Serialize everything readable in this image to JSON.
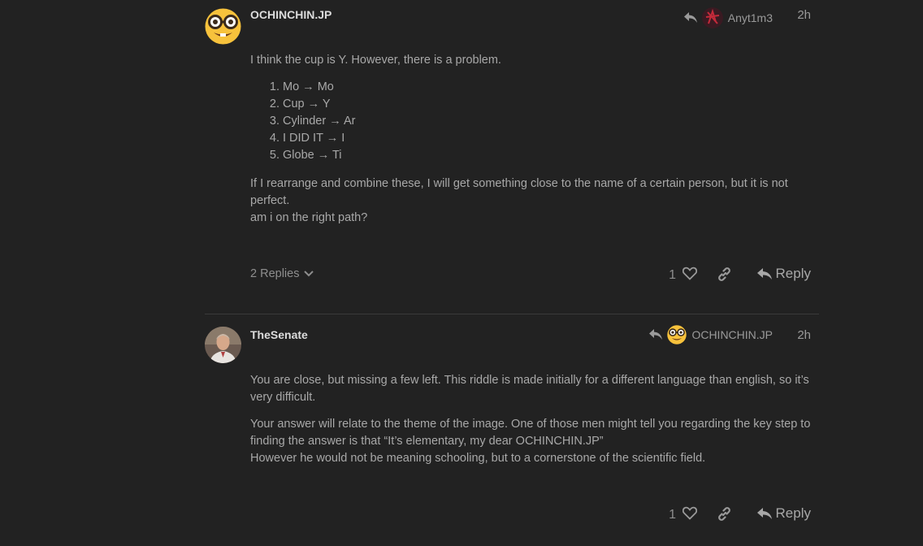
{
  "posts": [
    {
      "username": "OCHINCHIN.JP",
      "avatar_icon": "nerd-face-emoji-icon",
      "reply_to_user": "Anyt1m3",
      "age": "2h",
      "paragraph1": "I think the cup is Y. However, there is a problem.",
      "list": [
        "Mo → Mo",
        "Cup → Y",
        "Cylinder → Ar",
        "I DID IT → I",
        "Globe → Ti"
      ],
      "paragraph2_line1": "If I rearrange and combine these, I will get something close to the name of a certain person, but it is not perfect.",
      "paragraph2_line2": "am i on the right path?",
      "replies_label": "2 Replies",
      "likes": "1",
      "reply_label": "Reply"
    },
    {
      "username": "TheSenate",
      "avatar_icon": "user-photo-avatar",
      "reply_to_user": "OCHINCHIN.JP",
      "age": "2h",
      "paragraph1": "You are close, but missing a few left. This riddle is made initially for a different language than english, so it’s very difficult.",
      "paragraph2_line1": "Your answer will relate to the theme of the image. One of those men might tell you regarding the key step to finding the answer is that “It’s elementary, my dear OCHINCHIN.JP”",
      "paragraph2_line2": "However he would not be meaning schooling, but to a cornerstone of the scientific field.",
      "likes": "1",
      "reply_label": "Reply"
    }
  ],
  "colors": {
    "background": "#222222",
    "text": "#a8a8a8",
    "username": "#dcdcdc",
    "muted": "#8e8e8e",
    "divider": "#3a3a3a"
  }
}
